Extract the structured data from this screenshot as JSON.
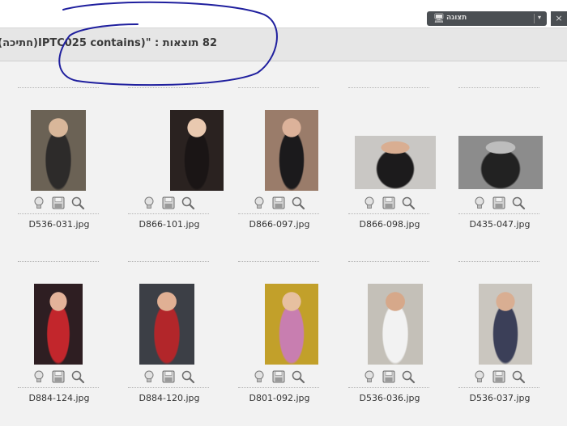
{
  "toolbar": {
    "view_label": "תצוגה",
    "monitor_icon": "monitor-icon",
    "caret_icon": "chevron-down-icon"
  },
  "results": {
    "count": "82",
    "label": "תוצאות :",
    "query": "\"(IPTC025 contains(חתיכה))\""
  },
  "annotation": {
    "color": "#1f1f9e",
    "shape": "hand-drawn ellipse around query text"
  },
  "thumbnail_actions": [
    "lightbulb-icon",
    "save-icon",
    "magnify-icon"
  ],
  "thumbnails": [
    {
      "filename": "D536-031.jpg",
      "bg": "#6b6255",
      "fg": "#2d2b2a",
      "skin": "#d9b79a"
    },
    {
      "filename": "D866-101.jpg",
      "bg": "#2a2220",
      "fg": "#1a1515",
      "skin": "#e9c9b0"
    },
    {
      "filename": "D866-097.jpg",
      "bg": "#9a7c6a",
      "fg": "#1b1a1c",
      "skin": "#dcb29a"
    },
    {
      "filename": "D866-098.jpg",
      "bg": "#c9c7c4",
      "fg": "#1c1b1c",
      "skin": "#d9ae92"
    },
    {
      "filename": "D435-047.jpg",
      "bg": "#8c8c8c",
      "fg": "#222222",
      "skin": "#bdbdbd"
    },
    {
      "filename": "D884-124.jpg",
      "bg": "#2e1e22",
      "fg": "#c2262c",
      "skin": "#e4b39a"
    },
    {
      "filename": "D884-120.jpg",
      "bg": "#3c3f46",
      "fg": "#b2262a",
      "skin": "#e0b094"
    },
    {
      "filename": "D801-092.jpg",
      "bg": "#c2a02a",
      "fg": "#c87eb0",
      "skin": "#e7c0a0"
    },
    {
      "filename": "D536-036.jpg",
      "bg": "#c4c0b8",
      "fg": "#f2f2f2",
      "skin": "#d6a88a"
    },
    {
      "filename": "D536-037.jpg",
      "bg": "#cac6bf",
      "fg": "#3b3f58",
      "skin": "#d9ae92"
    }
  ]
}
